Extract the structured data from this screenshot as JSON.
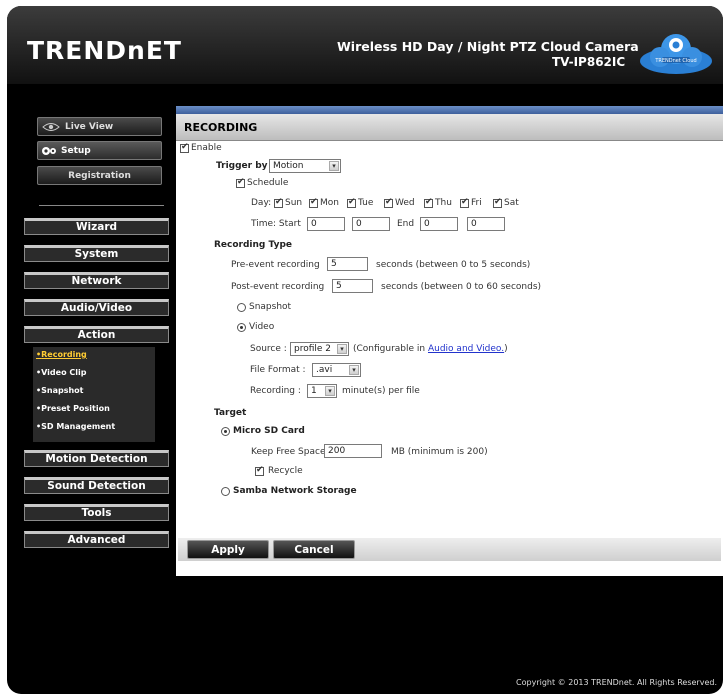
{
  "header": {
    "logo": "TRENDnET",
    "product_title": "Wireless HD Day / Night PTZ Cloud Camera",
    "model": "TV-IP862IC",
    "cloud_badge": "TRENDnet Cloud"
  },
  "sidebar": {
    "top_buttons": [
      {
        "label": "Live View",
        "icon": "live-view-icon"
      },
      {
        "label": "Setup",
        "icon": "gear-icon"
      },
      {
        "label": "Registration",
        "icon": ""
      }
    ],
    "nav": [
      "Wizard",
      "System",
      "Network",
      "Audio/Video",
      "Action"
    ],
    "action_items": [
      "Recording",
      "Video Clip",
      "Snapshot",
      "Preset Position",
      "SD Management"
    ],
    "active_action_item": "Recording",
    "nav_after": [
      "Motion Detection",
      "Sound Detection",
      "Tools",
      "Advanced"
    ]
  },
  "panel": {
    "title": "RECORDING",
    "enable_label": "Enable",
    "enable_checked": true,
    "trigger_label": "Trigger by",
    "trigger_value": "Motion",
    "schedule_label": "Schedule",
    "schedule_checked": true,
    "day_label": "Day:",
    "days": [
      {
        "label": "Sun",
        "checked": true
      },
      {
        "label": "Mon",
        "checked": true
      },
      {
        "label": "Tue",
        "checked": true
      },
      {
        "label": "Wed",
        "checked": true
      },
      {
        "label": "Thu",
        "checked": true
      },
      {
        "label": "Fri",
        "checked": true
      },
      {
        "label": "Sat",
        "checked": true
      }
    ],
    "time_start_label": "Time: Start",
    "start_h": "0",
    "start_m": "0",
    "end_label": "End",
    "end_h": "0",
    "end_m": "0",
    "recording_type_label": "Recording Type",
    "pre_event_label": "Pre-event recording",
    "pre_event_value": "5",
    "pre_event_hint": "seconds  (between 0 to 5 seconds)",
    "post_event_label": "Post-event recording",
    "post_event_value": "5",
    "post_event_hint": "seconds (between 0 to 60 seconds)",
    "snapshot_label": "Snapshot",
    "video_label": "Video",
    "video_selected": true,
    "source_label": "Source :",
    "source_value": "profile 2",
    "source_hint_prefix": "(Configurable in ",
    "source_hint_link": "Audio and Video.",
    "source_hint_suffix": ")",
    "file_format_label": "File Format :",
    "file_format_value": ".avi",
    "recording_label": "Recording :",
    "recording_value": "1",
    "recording_hint": "minute(s) per file",
    "target_label": "Target",
    "micro_sd_label": "Micro SD Card",
    "micro_sd_selected": true,
    "keep_free_label": "Keep Free Space",
    "keep_free_value": "200",
    "keep_free_hint": "MB (minimum is 200)",
    "recycle_label": "Recycle",
    "recycle_checked": true,
    "samba_label": "Samba Network Storage",
    "apply_label": "Apply",
    "cancel_label": "Cancel"
  },
  "footer": {
    "copyright": "Copyright © 2013 TRENDnet. All Rights Reserved."
  }
}
